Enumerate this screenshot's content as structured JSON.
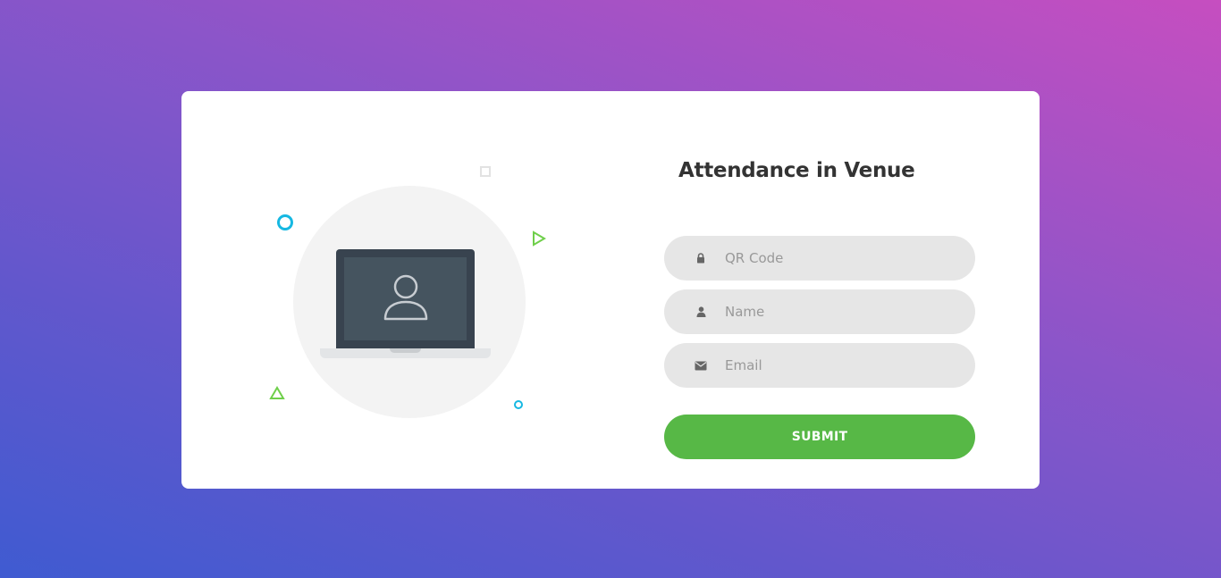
{
  "form": {
    "title": "Attendance in Venue",
    "fields": [
      {
        "placeholder": "QR Code",
        "value": "",
        "icon": "lock-icon"
      },
      {
        "placeholder": "Name",
        "value": "",
        "icon": "user-icon"
      },
      {
        "placeholder": "Email",
        "value": "",
        "icon": "envelope-icon"
      }
    ],
    "submit_label": "SUBMIT"
  },
  "illustration": {
    "icon": "laptop-user-icon"
  },
  "colors": {
    "accent_green": "#57b846",
    "decor_blue": "#16b8e2",
    "field_bg": "#e6e6e6",
    "gradient_start": "#3f5bd1",
    "gradient_end": "#c64ec0"
  }
}
